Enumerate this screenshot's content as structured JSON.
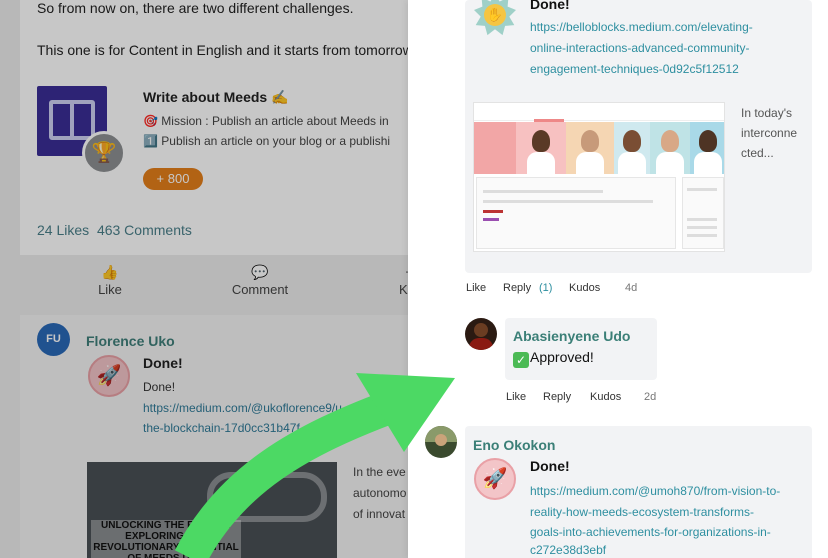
{
  "background": {
    "intro_line": "So from now on, there are two different challenges.",
    "english_line": "This one is for Content in English and it starts from tomorrow",
    "challenge": {
      "title": "Write about Meeds ✍️",
      "mission_line": "🎯 Mission : Publish an article about Meeds in",
      "task_line": "1️⃣ Publish an article on your blog or a publishi",
      "points": "+ 800"
    },
    "stats": {
      "likes": "24 Likes",
      "comments": "463 Comments"
    },
    "actions": {
      "like": "Like",
      "comment": "Comment",
      "kudos": "Ku"
    },
    "comment": {
      "avatar_initials": "FU",
      "author": "Florence Uko",
      "done_title": "Done!",
      "done_text": "Done!",
      "link_line1": "https://medium.com/@ukoflorence9/u",
      "link_line2": "the-blockchain-17d0cc31b47f",
      "preview_text": "UNLOCKING THE FUTURE: EXPLORING THE REVOLUTIONARY POTENTIAL OF MEEDS DAO",
      "side_line1": "In the eve",
      "side_line2": "autonomo",
      "side_line3": "of innovat"
    }
  },
  "drawer": {
    "first_comment": {
      "done_title": "Done!",
      "link_line1": "https://belloblocks.medium.com/elevating-",
      "link_line2": "online-interactions-advanced-community-",
      "link_line3": "engagement-techniques-0d92c5f12512",
      "preview_side_line1": "In today's",
      "preview_side_line2": "interconne",
      "preview_side_line3": "cted...",
      "actions": {
        "like": "Like",
        "reply": "Reply",
        "reply_count": "(1)",
        "kudos": "Kudos",
        "time": "4d"
      }
    },
    "reply": {
      "author": "Abasienyene Udo",
      "text": "Approved!",
      "actions": {
        "like": "Like",
        "reply": "Reply",
        "kudos": "Kudos",
        "time": "2d"
      }
    },
    "second_comment": {
      "author": "Eno Okokon",
      "done_title": "Done!",
      "link_line1": "https://medium.com/@umoh870/from-vision-to-",
      "link_line2": "reality-how-meeds-ecosystem-transforms-",
      "link_line3": "goals-into-achievements-for-organizations-in-",
      "link_line4": "c272e38d3ebf"
    }
  },
  "colors": {
    "link": "#2e8fa0",
    "author": "#3b7f77",
    "points_badge": "#e57f1a",
    "arrow": "#4cd964"
  },
  "icons": [
    "book-icon",
    "trophy-icon",
    "thumbs-up-icon",
    "comment-icon",
    "rocket-icon",
    "kudos-star-icon",
    "checkmark-icon",
    "arrow-overlay"
  ]
}
